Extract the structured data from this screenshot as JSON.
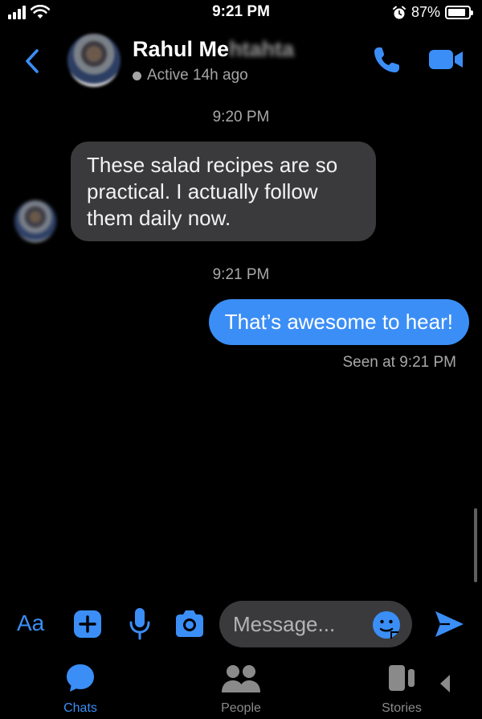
{
  "status_bar": {
    "time": "9:21 PM",
    "battery": "87%"
  },
  "header": {
    "contact_name_visible": "Rahul Me",
    "contact_name_blurred": "htahta",
    "status": "Active 14h ago"
  },
  "conversation": {
    "timestamp_1": "9:20 PM",
    "incoming_message": "These salad recipes are so practical. I actually follow them daily now.",
    "timestamp_2": "9:21 PM",
    "outgoing_message": "That’s awesome to hear!",
    "seen_status": "Seen at 9:21 PM"
  },
  "composer": {
    "aa_label": "Aa",
    "placeholder": "Message..."
  },
  "tabs": [
    {
      "label": "Chats",
      "icon": "chat-bubble-icon",
      "active": true
    },
    {
      "label": "People",
      "icon": "people-icon",
      "active": false
    },
    {
      "label": "Stories",
      "icon": "stories-icon",
      "active": false
    }
  ],
  "colors": {
    "accent": "#3b8ef6",
    "incoming_bubble": "#3a3a3c",
    "background": "#000000",
    "muted_text": "#a8a8a8"
  },
  "icons": [
    "back-chevron-icon",
    "phone-icon",
    "video-camera-icon",
    "plus-icon",
    "microphone-icon",
    "camera-icon",
    "emoji-icon",
    "send-icon",
    "chat-bubble-icon",
    "people-icon",
    "stories-icon",
    "nav-back-icon",
    "alarm-icon",
    "wifi-icon",
    "signal-icon",
    "battery-icon"
  ]
}
